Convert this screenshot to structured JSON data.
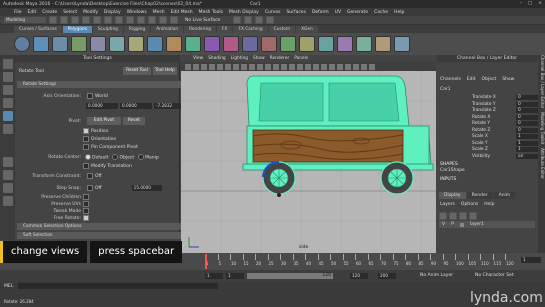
{
  "window": {
    "title": "Autodesk Maya 2016 - C:\\Users\\Lynda\\Desktop\\Exercise Files\\Chap02\\scenes\\02_04.ma*",
    "title_suffix": "Car1",
    "controls": [
      "–",
      "□",
      "×"
    ]
  },
  "menubar": {
    "items": [
      "File",
      "Edit",
      "Create",
      "Select",
      "Modify",
      "Display",
      "Windows",
      "Mesh",
      "Edit Mesh",
      "Mesh Tools",
      "Mesh Display",
      "Curves",
      "Surfaces",
      "Deform",
      "UV",
      "Generate",
      "Cache",
      "Help"
    ]
  },
  "status_line": {
    "mode": "Modeling",
    "surface_label": "No Live Surface"
  },
  "shelf": {
    "tabs": [
      "Curves / Surfaces",
      "Polygons",
      "Sculpting",
      "Rigging",
      "Animation",
      "Rendering",
      "FX",
      "FX Caching",
      "Custom",
      "XGen"
    ],
    "active_tab": "Polygons"
  },
  "tool_settings": {
    "header": "Tool Settings",
    "tool_name": "Rotate Tool",
    "reset_label": "Reset Tool",
    "help_label": "Tool Help",
    "section_rotate": "Rotate Settings",
    "axis_orientation_label": "Axis Orientation:",
    "axis_orientation_value": "World",
    "values": [
      "0.0000",
      "0.0000",
      "-7.2832"
    ],
    "pivot_label": "Pivot:",
    "edit_pivot_label": "Edit Pivot",
    "pivot_reset_label": "Reset",
    "position_label": "Position",
    "orientation_label": "Orientation",
    "pin_pivot_label": "Pin Component Pivot",
    "rotate_center_label": "Rotate Center:",
    "rotate_center_options": [
      "Default",
      "Object",
      "Manip"
    ],
    "modify_translation_label": "Modify Translation",
    "transform_constraint_label": "Transform Constraint:",
    "transform_constraint_value": "Off",
    "step_snap_label": "Step Snap:",
    "step_snap_value": "Off",
    "step_snap_amount": "15.0000",
    "preserve_children_label": "Preserve Children",
    "preserve_uvs_label": "Preserve UVs",
    "tweak_mode_label": "Tweak Mode",
    "free_rotate_label": "Free Rotate:",
    "section_common": "Common Selection Options",
    "section_soft": "Soft Selection"
  },
  "viewport": {
    "menu": [
      "View",
      "Shading",
      "Lighting",
      "Show",
      "Renderer",
      "Panels"
    ],
    "label": "side"
  },
  "channel_box": {
    "header": "Channel Box / Layer Editor",
    "tabs": [
      "Channels",
      "Edit",
      "Object",
      "Show"
    ],
    "object_name": "Car1",
    "attributes": [
      {
        "name": "Translate X",
        "value": "0"
      },
      {
        "name": "Translate Y",
        "value": "0"
      },
      {
        "name": "Translate Z",
        "value": "0"
      },
      {
        "name": "Rotate X",
        "value": "0"
      },
      {
        "name": "Rotate Y",
        "value": "0"
      },
      {
        "name": "Rotate Z",
        "value": "0"
      },
      {
        "name": "Scale X",
        "value": "1"
      },
      {
        "name": "Scale Y",
        "value": "1"
      },
      {
        "name": "Scale Z",
        "value": "1"
      },
      {
        "name": "Visibility",
        "value": "on"
      }
    ],
    "shapes_label": "SHAPES",
    "shape_name": "Car1Shape",
    "inputs_label": "INPUTS",
    "layer_tabs": [
      "Display",
      "Render",
      "Anim"
    ],
    "layer_menu": [
      "Layers",
      "Options",
      "Help"
    ],
    "layer_row": {
      "v": "V",
      "p": "P",
      "name": "layer1"
    },
    "side_tabs": [
      "Channel Box / Layer Editor",
      "Modeling Toolkit",
      "Attribute Editor"
    ]
  },
  "timeline": {
    "ticks": [
      "1",
      "5",
      "10",
      "15",
      "20",
      "25",
      "30",
      "35",
      "40",
      "45",
      "50",
      "55",
      "60",
      "65",
      "70",
      "75",
      "80",
      "85",
      "90",
      "95",
      "100",
      "105",
      "110",
      "115",
      "120"
    ],
    "current_frame": "1"
  },
  "range": {
    "start": "1",
    "inner_start": "1",
    "inner_end": "120",
    "end": "120",
    "end2": "200",
    "anim_layer": "No Anim Layer",
    "char_set": "No Character Set"
  },
  "command_line": {
    "lang": "MEL"
  },
  "help_line": {
    "text": "Rotate: 26.284"
  },
  "caption": {
    "left": "change views",
    "right": "press spacebar"
  },
  "watermark": "lynda.com",
  "colors": {
    "selection_highlight": "#5ff0c0",
    "accent_blue": "#5a89b4",
    "caption_bar": "#f0c020"
  }
}
